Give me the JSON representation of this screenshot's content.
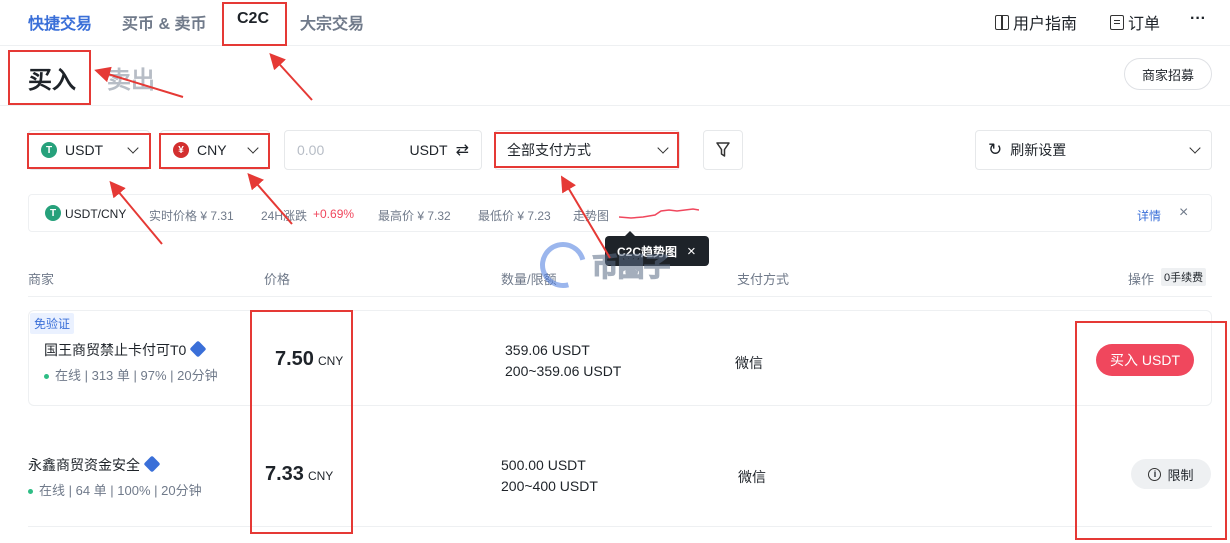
{
  "nav": {
    "tabs": [
      "快捷交易",
      "买币 & 卖币",
      "C2C",
      "大宗交易"
    ],
    "guide": "用户指南",
    "orders": "订单",
    "more": "···"
  },
  "trade": {
    "buy": "买入",
    "sell": "卖出",
    "recruit": "商家招募"
  },
  "filters": {
    "coin": "USDT",
    "fiat": "CNY",
    "fiat_symbol": "¥",
    "coin_symbol": "T",
    "amount_placeholder": "0.00",
    "amount_unit": "USDT",
    "payment": "全部支付方式",
    "refresh": "刷新设置"
  },
  "ticker": {
    "pair": "USDT/CNY",
    "realtime": "实时价格 ¥ 7.31",
    "change_label": "24H涨跌",
    "change_value": "+0.69%",
    "high": "最高价 ¥ 7.32",
    "low": "最低价 ¥ 7.23",
    "trend": "走势图",
    "details": "详情",
    "close": "×"
  },
  "tooltip": {
    "label": "C2C趋势图",
    "close": "×"
  },
  "table": {
    "headers": [
      "商家",
      "价格",
      "数量/限额",
      "支付方式",
      "操作"
    ],
    "fee_badge": "0手续费"
  },
  "rows": [
    {
      "badge": "免验证",
      "merchant": "国王商贸禁止卡付可T0",
      "stats": "在线 | 313 单 | 97% | 20分钟",
      "price": "7.50",
      "currency": "CNY",
      "quantity": "359.06 USDT",
      "limit": "200~359.06 USDT",
      "payment": "微信",
      "action": "买入 USDT"
    },
    {
      "merchant": "永鑫商贸资金安全",
      "stats": "在线 | 64 单 | 100% | 20分钟",
      "price": "7.33",
      "currency": "CNY",
      "quantity": "500.00 USDT",
      "limit": "200~400 USDT",
      "payment": "微信",
      "action": "限制"
    }
  ],
  "watermark": "币圈子",
  "colors": {
    "accent": "#3a6fd8",
    "buy": "#f0475d",
    "up": "#f0475d",
    "annotation": "#e53935",
    "usdt": "#26a17b",
    "cny": "#d32f2f"
  }
}
